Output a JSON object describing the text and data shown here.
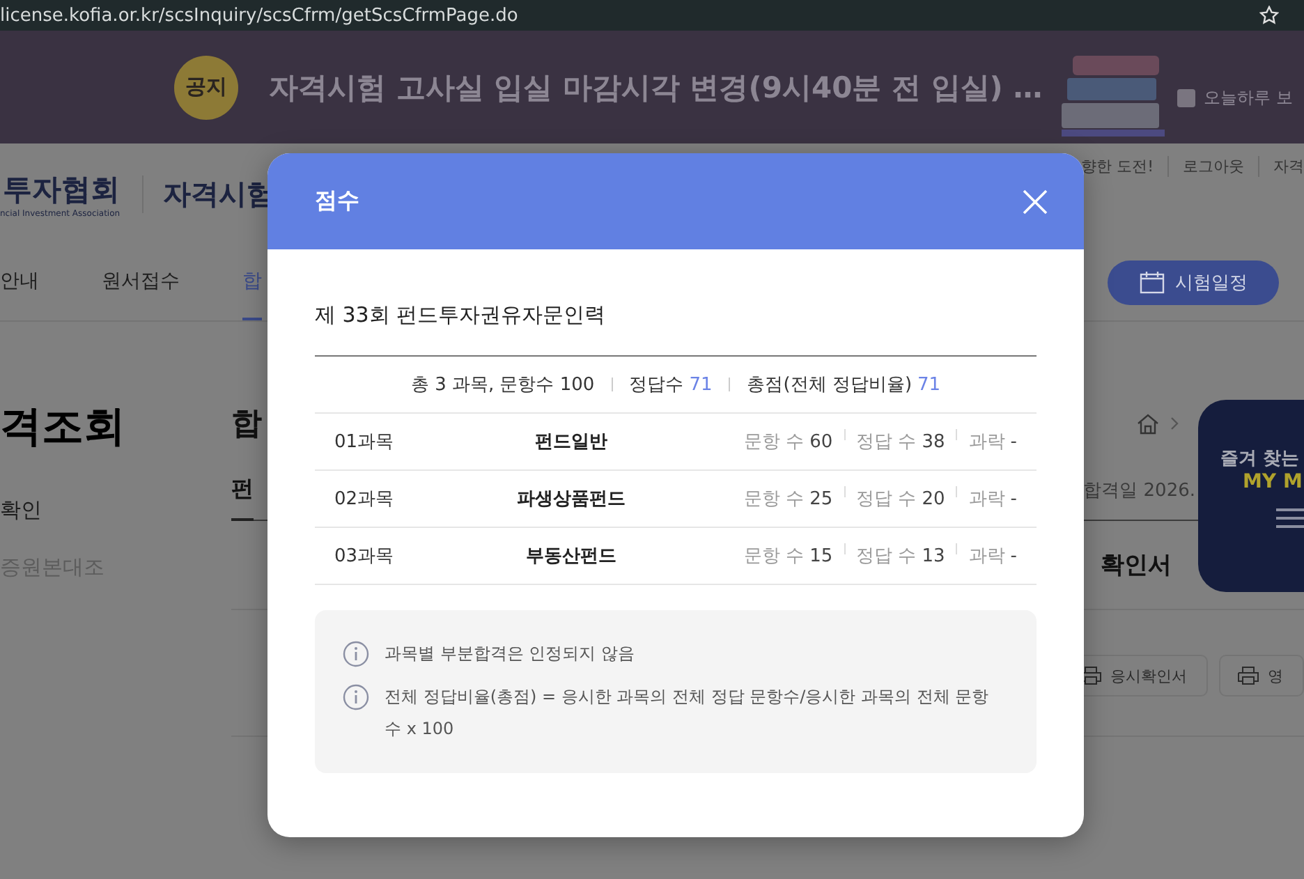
{
  "browser": {
    "url": "license.kofia.or.kr/scsInquiry/scsCfrm/getScsCfrmPage.do"
  },
  "notice": {
    "badge": "공지",
    "title": "자격시험 고사실 입실 마감시각 변경(9시40분 전 입실) …",
    "hide_today": {
      "label": "오늘하루 보",
      "checked": false
    }
  },
  "header": {
    "logo_text": "투자협회",
    "logo_subtitle": "ncial Investment Association",
    "site_name": "자격시험",
    "links": [
      "향한 도전!",
      "로그아웃",
      "자격"
    ]
  },
  "nav": {
    "items": [
      {
        "label": "안내",
        "selected": false
      },
      {
        "label": "원서접수",
        "selected": false
      },
      {
        "label": "합",
        "selected": true
      }
    ],
    "schedule_button": "시험일정"
  },
  "sidebar": {
    "title": "격조회",
    "items": [
      {
        "label": "확인",
        "selected": true
      },
      {
        "label": "증원본대조",
        "selected": false
      }
    ]
  },
  "content": {
    "title": "합",
    "tab": "펀",
    "pass_date": "합격일 2026.",
    "section_title": "확인서",
    "buttons": [
      "응시확인서",
      "영"
    ]
  },
  "quick_menu": {
    "line1": "즐겨 찾는",
    "line2": "MY M"
  },
  "modal": {
    "title": "점수",
    "exam": "제 33회 펀드투자권유자문인력",
    "summary": {
      "subjects": "총 3 과목, 문항수 100",
      "correct_label": "정답수",
      "correct": "71",
      "total_label": "총점(전체 정답비율)",
      "total": "71"
    },
    "rows": [
      {
        "number": "01과목",
        "name": "펀드일반",
        "questions_label": "문항 수",
        "questions": "60",
        "correct_label": "정답 수",
        "correct": "38",
        "fail_label": "과락",
        "fail": "-"
      },
      {
        "number": "02과목",
        "name": "파생상품펀드",
        "questions_label": "문항 수",
        "questions": "25",
        "correct_label": "정답 수",
        "correct": "20",
        "fail_label": "과락",
        "fail": "-"
      },
      {
        "number": "03과목",
        "name": "부동산펀드",
        "questions_label": "문항 수",
        "questions": "15",
        "correct_label": "정답 수",
        "correct": "13",
        "fail_label": "과락",
        "fail": "-"
      }
    ],
    "notes": [
      "과목별 부분합격은 인정되지 않음",
      "전체 정답비율(총점) = 응시한 과목의 전체 정답 문항수/응시한 과목의 전체 문항수 x 100"
    ]
  }
}
